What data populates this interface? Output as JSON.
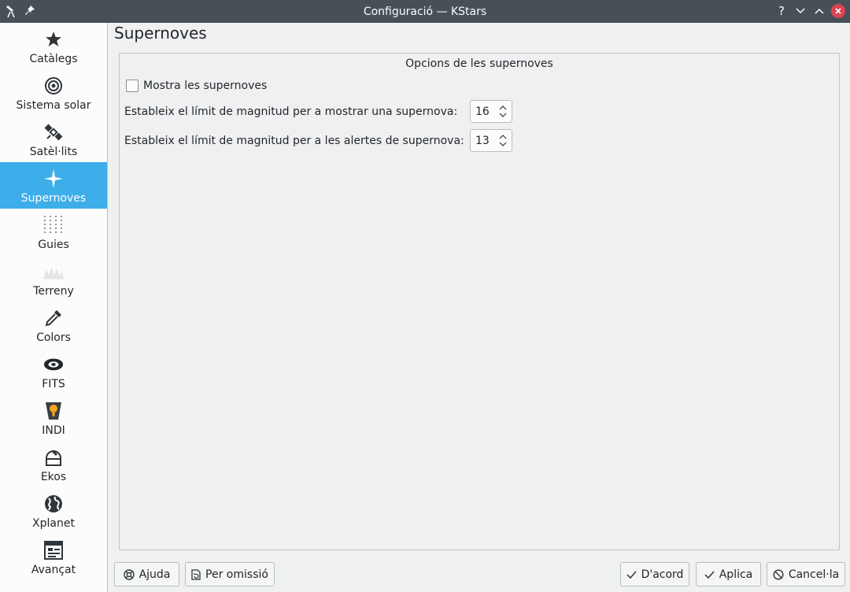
{
  "window": {
    "title": "Configuració — KStars"
  },
  "titlebar": {
    "help_glyph": "?",
    "minimize_glyph": "⌄",
    "maximize_glyph": "⌃"
  },
  "sidebar": {
    "items": [
      {
        "label": "Catàlegs",
        "icon": "star-icon"
      },
      {
        "label": "Sistema solar",
        "icon": "solar-system-icon"
      },
      {
        "label": "Satèl·lits",
        "icon": "satellite-icon"
      },
      {
        "label": "Supernoves",
        "icon": "supernova-icon",
        "active": true
      },
      {
        "label": "Guies",
        "icon": "guides-grid-icon"
      },
      {
        "label": "Terreny",
        "icon": "terrain-icon"
      },
      {
        "label": "Colors",
        "icon": "color-picker-icon"
      },
      {
        "label": "FITS",
        "icon": "galaxy-icon"
      },
      {
        "label": "INDI",
        "icon": "indi-icon"
      },
      {
        "label": "Ekos",
        "icon": "observatory-dome-icon"
      },
      {
        "label": "Xplanet",
        "icon": "globe-icon"
      },
      {
        "label": "Avançat",
        "icon": "advanced-settings-icon"
      }
    ]
  },
  "main": {
    "page_title": "Supernoves",
    "group_title": "Opcions de les supernoves",
    "show_checkbox": {
      "label": "Mostra les supernoves",
      "checked": false
    },
    "display_limit": {
      "label": "Estableix el límit de magnitud per a mostrar una supernova:",
      "value": "16"
    },
    "alert_limit": {
      "label": "Estableix el límit de magnitud per a les alertes de supernova:",
      "value": "13"
    }
  },
  "buttons": {
    "help": "Ajuda",
    "defaults": "Per omissió",
    "ok": "D'acord",
    "apply": "Aplica",
    "cancel": "Cancel·la"
  },
  "colors": {
    "accent": "#3daee9",
    "titlebar": "#475057",
    "close": "#da4453"
  }
}
